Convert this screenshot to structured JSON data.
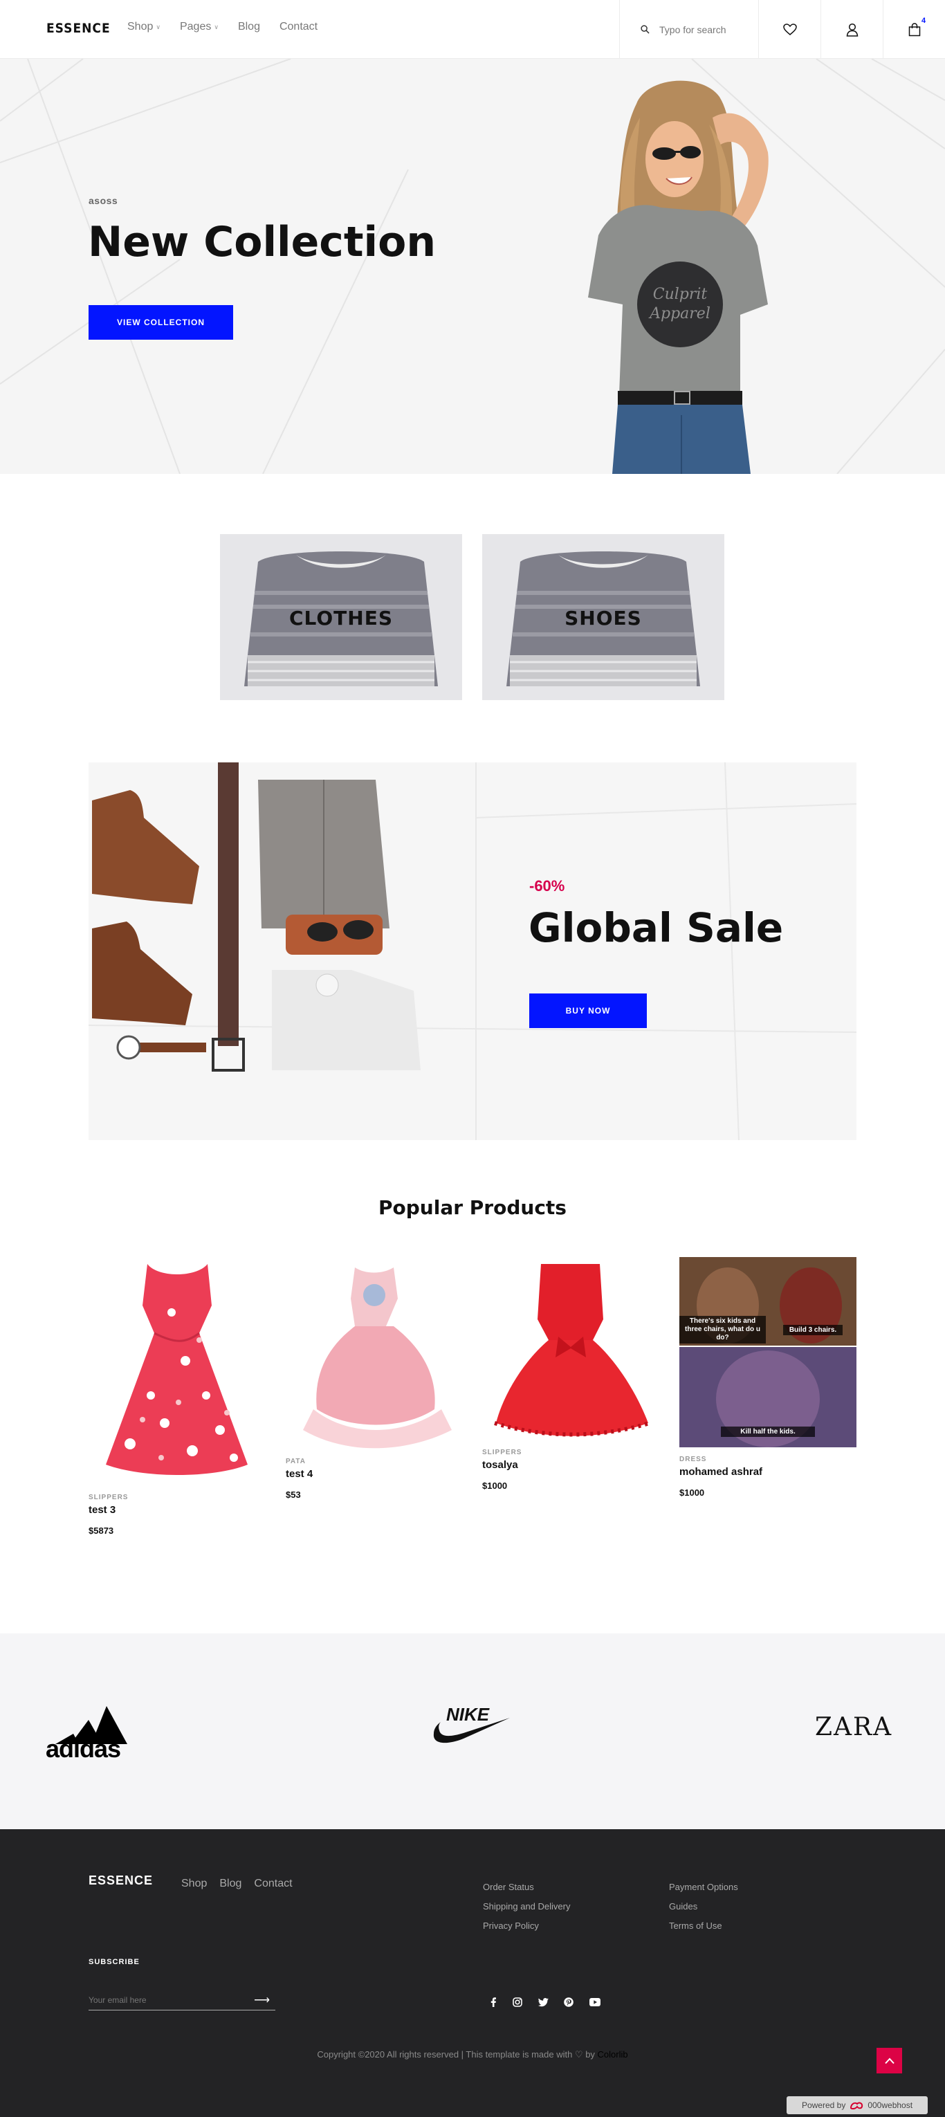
{
  "header": {
    "logo": "ESSENCE",
    "nav": [
      {
        "label": "Shop",
        "has_dropdown": true
      },
      {
        "label": "Pages",
        "has_dropdown": true
      },
      {
        "label": "Blog",
        "has_dropdown": false
      },
      {
        "label": "Contact",
        "has_dropdown": false
      }
    ],
    "search_placeholder": "Typo for search",
    "cart_count": "4",
    "icons": [
      "search-icon",
      "heart-icon",
      "user-icon",
      "cart-icon"
    ]
  },
  "hero": {
    "subtitle": "asoss",
    "title": "New Collection",
    "button": "VIEW COLLECTION"
  },
  "categories": [
    {
      "label": "CLOTHES"
    },
    {
      "label": "SHOES"
    }
  ],
  "sale": {
    "discount": "-60%",
    "title": "Global Sale",
    "button": "BUY NOW"
  },
  "popular": {
    "title": "Popular Products",
    "products": [
      {
        "category": "SLIPPERS",
        "name": "test 3",
        "price": "$5873"
      },
      {
        "category": "PATA",
        "name": "test 4",
        "price": "$53"
      },
      {
        "category": "SLIPPERS",
        "name": "tosalya",
        "price": "$1000"
      },
      {
        "category": "DRESS",
        "name": "mohamed ashraf",
        "price": "$1000"
      }
    ],
    "meme_captions": [
      "There's six kids and three chairs, what do u do?",
      "Build 3 chairs.",
      "Kill half the kids."
    ]
  },
  "brands": [
    "adidas",
    "NIKE",
    "ZARA"
  ],
  "footer": {
    "logo": "ESSENCE",
    "nav": [
      "Shop",
      "Blog",
      "Contact"
    ],
    "col1": [
      "Order Status",
      "Shipping and Delivery",
      "Privacy Policy"
    ],
    "col2": [
      "Payment Options",
      "Guides",
      "Terms of Use"
    ],
    "subscribe_label": "SUBSCRIBE",
    "email_placeholder": "Your email here",
    "social_icons": [
      "facebook-icon",
      "instagram-icon",
      "twitter-icon",
      "pinterest-icon",
      "youtube-icon"
    ],
    "copyright": "Copyright ©2020 All rights reserved | This template is made with ♡ by",
    "copyright_link": "Colorlib",
    "powered_by": "Powered by",
    "powered_brand": "000webhost"
  },
  "colors": {
    "accent": "#0315ff",
    "sale": "#d6004c",
    "footer_bg": "#232325",
    "to_top": "#dc0345"
  }
}
